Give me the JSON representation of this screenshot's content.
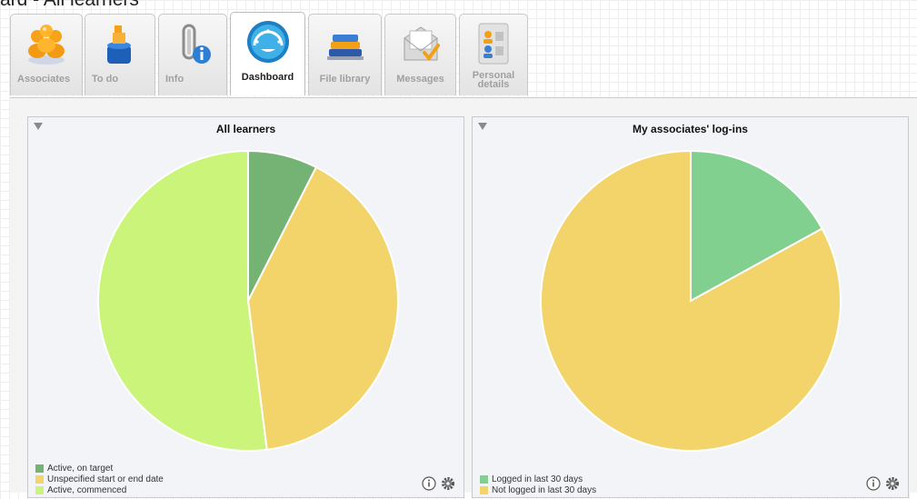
{
  "page": {
    "title": "ard - All learners"
  },
  "tabs": [
    {
      "label": "Associates",
      "icon": "associates-icon",
      "active": false
    },
    {
      "label": "To do",
      "icon": "todo-icon",
      "active": false
    },
    {
      "label": "Info",
      "icon": "info-icon",
      "active": false
    },
    {
      "label": "Dashboard",
      "icon": "dashboard-icon",
      "active": true
    },
    {
      "label": "File library",
      "icon": "file-library-icon",
      "active": false
    },
    {
      "label": "Messages",
      "icon": "messages-icon",
      "active": false
    },
    {
      "label": "Personal details",
      "icon": "personal-details-icon",
      "active": false
    }
  ],
  "panels": {
    "learners": {
      "title": "All learners",
      "legend": [
        "Active, on target",
        "Unspecified start or end date",
        "Active, commenced"
      ]
    },
    "logins": {
      "title": "My associates' log-ins",
      "legend": [
        "Logged in last 30 days",
        "Not logged in last 30 days"
      ]
    }
  },
  "chart_data": [
    {
      "type": "pie",
      "title": "All learners",
      "categories": [
        "Active, on target",
        "Unspecified start or end date",
        "Active, commenced"
      ],
      "values": [
        7.5,
        40.5,
        52
      ],
      "colors": [
        "#74b374",
        "#f2d46b",
        "#caf57a"
      ]
    },
    {
      "type": "pie",
      "title": "My associates' log-ins",
      "categories": [
        "Logged in last 30 days",
        "Not logged in last 30 days"
      ],
      "values": [
        17,
        83
      ],
      "colors": [
        "#82d08f",
        "#f2d46b"
      ]
    }
  ]
}
